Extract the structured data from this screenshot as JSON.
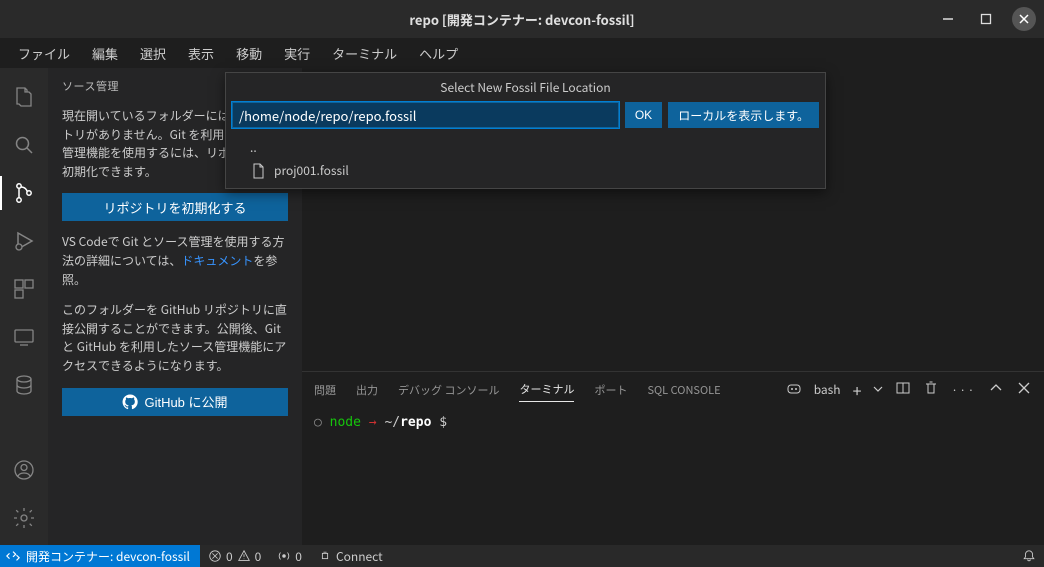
{
  "window": {
    "title": "repo [開発コンテナー: devcon-fossil]"
  },
  "menu": {
    "file": "ファイル",
    "edit": "編集",
    "select": "選択",
    "view": "表示",
    "go": "移動",
    "run": "実行",
    "terminal": "ターミナル",
    "help": "ヘルプ"
  },
  "sidebar": {
    "title": "ソース管理",
    "empty_text": "現在開いているフォルダーには Git リポジトリがありません。Git を利用したソース管理機能を使用するには、リポジトリを初期化できます。",
    "init_button": "リポジトリを初期化する",
    "docs_text_1": "VS Codeで Git とソース管理を使用する方法の詳細については、",
    "docs_link": "ドキュメント",
    "docs_text_2": "を参照。",
    "publish_text": "このフォルダーを GitHub リポジトリに直接公開することができます。公開後、Git と GitHub を利用したソース管理機能にアクセスできるようになります。",
    "publish_button": "GitHub に公開"
  },
  "quickinput": {
    "title": "Select New Fossil File Location",
    "value": "/home/node/repo/repo.fossil",
    "ok": "OK",
    "show_local": "ローカルを表示します。",
    "items": {
      "up": "..",
      "file1": "proj001.fossil"
    }
  },
  "panel": {
    "tabs": {
      "problems": "問題",
      "output": "出力",
      "debug": "デバッグ コンソール",
      "terminal": "ターミナル",
      "ports": "ポート",
      "sql": "SQL CONSOLE"
    },
    "shell": "bash"
  },
  "terminal": {
    "user": "node",
    "path_pre": "~/",
    "path_bold": "repo",
    "prompt": "$"
  },
  "status": {
    "remote": "開発コンテナー: devcon-fossil",
    "errors": "0",
    "warnings": "0",
    "ports": "0",
    "connect": "Connect"
  }
}
